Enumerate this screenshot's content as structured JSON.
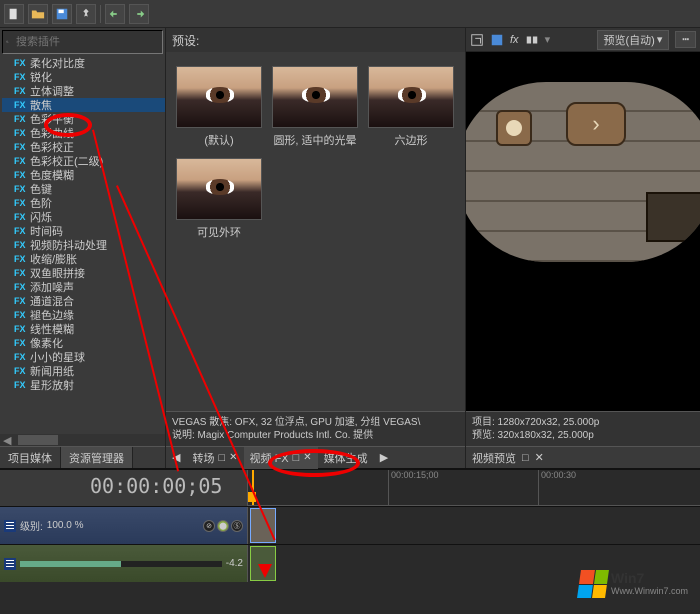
{
  "toolbar": {
    "icons": [
      "new",
      "open",
      "save",
      "pin",
      "undo",
      "redo"
    ]
  },
  "search": {
    "placeholder": "搜索插件"
  },
  "fx_list": [
    "柔化对比度",
    "锐化",
    "立体调整",
    "散焦",
    "色彩平衡",
    "色彩曲线",
    "色彩校正",
    "色彩校正(二级)",
    "色度模糊",
    "色键",
    "色阶",
    "闪烁",
    "时间码",
    "视频防抖动处理",
    "收缩/膨胀",
    "双鱼眼拼接",
    "添加噪声",
    "通道混合",
    "褪色边缘",
    "线性模糊",
    "像素化",
    "小小的星球",
    "新闻用纸",
    "星形放射"
  ],
  "fx_selected_index": 3,
  "bottom_tabs": {
    "left": "项目媒体",
    "right": "资源管理器"
  },
  "presets": {
    "header": "预设:",
    "items": [
      "(默认)",
      "圆形, 适中的光晕",
      "六边形",
      "可见外环"
    ]
  },
  "info": {
    "line1": "VEGAS 散焦: OFX, 32 位浮点, GPU 加速, 分组 VEGAS\\",
    "line2": "说明: Magix Computer Products Intl. Co. 提供"
  },
  "mid_tabs": {
    "left_arrow": "◀",
    "t1": "转场",
    "t2": "视频 FX",
    "t3": "媒体生成",
    "right_arrow": "▶"
  },
  "preview": {
    "toolbar": {
      "dropdown": "预览(自动)",
      "menu": "┅"
    },
    "info1": "项目: 1280x720x32, 25.000p",
    "info2": "预览: 320x180x32, 25.000p",
    "tab": "视频预览"
  },
  "timeline": {
    "timecode": "00:00:00;05",
    "marks": [
      "00:00:15;00",
      "00:00:30"
    ],
    "track1": {
      "label": "级别:",
      "value": "100.0 %"
    },
    "track2": {
      "value": "-4.2"
    }
  },
  "watermark": {
    "brand1": "Wi",
    "brand2": "n7",
    "url": "Www.Winwin7.com"
  }
}
